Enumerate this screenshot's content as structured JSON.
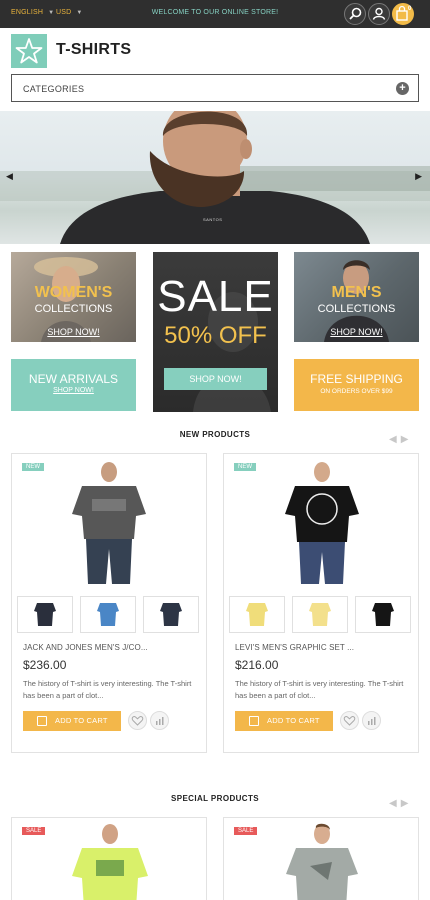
{
  "topbar": {
    "language": "ENGLISH",
    "currency": "USD",
    "welcome": "WELCOME TO OUR ONLINE STORE!",
    "cart_count": "0",
    "icons": [
      "search-icon",
      "user-icon",
      "cart-icon"
    ]
  },
  "header": {
    "title": "T-SHIRTS",
    "logo_icon": "star-icon"
  },
  "categories": {
    "label": "CATEGORIES"
  },
  "hero": {
    "shirt_text": "SANTOS"
  },
  "promos": {
    "women": {
      "title": "WOMEN'S",
      "subtitle": "COLLECTIONS",
      "link": "SHOP NOW!"
    },
    "sale": {
      "title": "SALE",
      "subtitle": "50% OFF",
      "button": "SHOP NOW!"
    },
    "men": {
      "title": "MEN'S",
      "subtitle": "COLLECTIONS",
      "link": "SHOP NOW!"
    },
    "arrivals": {
      "title": "NEW ARRIVALS",
      "link": "SHOP NOW!"
    },
    "shipping": {
      "title": "FREE SHIPPING",
      "subtitle": "ON ORDERS OVER $99"
    }
  },
  "new_products": {
    "title": "NEW PRODUCTS",
    "items": [
      {
        "badge": "NEW",
        "name": "JACK AND JONES MEN'S J/CO...",
        "price": "$236.00",
        "description": "The history of T-shirt is very interesting. The T-shirt has been a part of clot...",
        "add_to_cart": "ADD TO CART"
      },
      {
        "badge": "NEW",
        "name": "LEVI'S MEN'S GRAPHIC SET ...",
        "price": "$216.00",
        "description": "The history of T-shirt is very interesting. The T-shirt has been a part of clot...",
        "add_to_cart": "ADD TO CART"
      }
    ]
  },
  "special_products": {
    "title": "SPECIAL PRODUCTS",
    "items": [
      {
        "badge": "SALE"
      },
      {
        "badge": "SALE"
      }
    ]
  },
  "colors": {
    "topbar": "#2f2f2f",
    "accent_teal": "#86cfbe",
    "accent_yellow": "#f3b74a",
    "sale_red": "#e75a5a"
  }
}
